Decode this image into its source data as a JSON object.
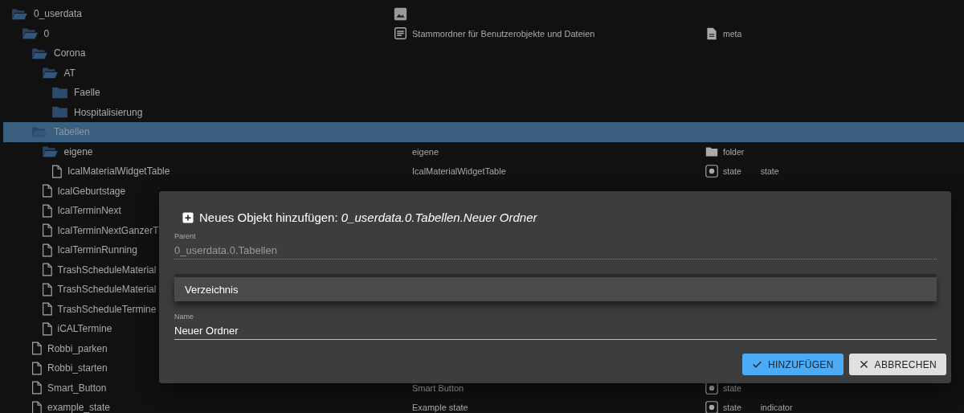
{
  "tree": [
    {
      "name": "0_userdata",
      "kind": "folder",
      "expanded": true,
      "selected": false,
      "desc": {
        "kind": "image"
      },
      "children": [
        {
          "name": "0",
          "kind": "folder",
          "expanded": true,
          "selected": false,
          "desc": {
            "kind": "note",
            "text": "Stammordner für Benutzerobjekte und Dateien"
          },
          "type": {
            "kind": "meta",
            "label": "meta"
          },
          "children": [
            {
              "name": "Corona",
              "kind": "folder",
              "expanded": true,
              "selected": false,
              "children": [
                {
                  "name": "AT",
                  "kind": "folder",
                  "expanded": true,
                  "selected": false,
                  "children": [
                    {
                      "name": "Faelle",
                      "kind": "folder",
                      "expanded": false,
                      "selected": false
                    },
                    {
                      "name": "Hospitalisierung",
                      "kind": "folder",
                      "expanded": false,
                      "selected": false
                    }
                  ]
                }
              ]
            },
            {
              "name": "Tabellen",
              "kind": "folder",
              "expanded": true,
              "selected": true,
              "children": [
                {
                  "name": "eigene",
                  "kind": "folder",
                  "expanded": true,
                  "selected": false,
                  "desc": {
                    "text": "eigene"
                  },
                  "type": {
                    "kind": "folder",
                    "label": "folder"
                  },
                  "children": [
                    {
                      "name": "IcalMaterialWidgetTable",
                      "kind": "file",
                      "selected": false,
                      "desc": {
                        "text": "IcalMaterialWidgetTable"
                      },
                      "type": {
                        "kind": "state",
                        "label": "state"
                      },
                      "role": "state"
                    }
                  ]
                },
                {
                  "name": "IcalGeburtstage",
                  "kind": "file",
                  "selected": false
                },
                {
                  "name": "IcalTerminNext",
                  "kind": "file",
                  "selected": false
                },
                {
                  "name": "IcalTerminNextGanzerT",
                  "kind": "file",
                  "selected": false
                },
                {
                  "name": "IcalTerminRunning",
                  "kind": "file",
                  "selected": false
                },
                {
                  "name": "TrashScheduleMaterial",
                  "kind": "file",
                  "selected": false
                },
                {
                  "name": "TrashScheduleMaterial",
                  "kind": "file",
                  "selected": false
                },
                {
                  "name": "TrashScheduleTermine",
                  "kind": "file",
                  "selected": false
                },
                {
                  "name": "iCALTermine",
                  "kind": "file",
                  "selected": false
                }
              ]
            },
            {
              "name": "Robbi_parken",
              "kind": "file",
              "selected": false
            },
            {
              "name": "Robbi_starten",
              "kind": "file",
              "selected": false
            },
            {
              "name": "Smart_Button",
              "kind": "file",
              "selected": false,
              "desc": {
                "text": "Smart Button"
              },
              "type": {
                "kind": "state",
                "label": "state"
              }
            },
            {
              "name": "example_state",
              "kind": "file",
              "selected": false,
              "desc": {
                "text": "Example state"
              },
              "type": {
                "kind": "state",
                "label": "state"
              },
              "role": "indicator"
            }
          ]
        }
      ]
    }
  ],
  "dialog": {
    "title": "Neues Objekt hinzufügen: *0_userdata.0.Tabellen.Neuer Ordner*",
    "parent": {
      "label": "Parent",
      "value": "0_userdata.0.Tabellen"
    },
    "type_menu": [
      {
        "label": "Verzeichnis",
        "selected": true
      }
    ],
    "name": {
      "label": "Name",
      "value": "Neuer Ordner"
    },
    "buttons": [
      {
        "kind": "confirm",
        "label": "HINZUFÜGEN"
      },
      {
        "kind": "cancel",
        "label": "ABBRECHEN"
      }
    ]
  }
}
